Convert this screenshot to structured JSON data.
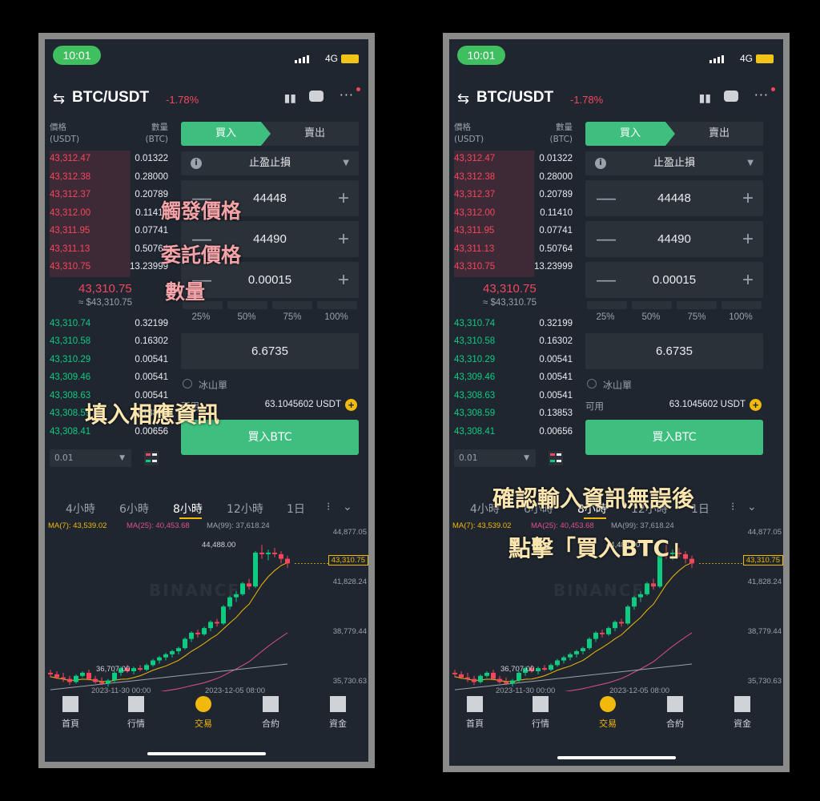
{
  "status": {
    "time": "10:01",
    "network": "4G"
  },
  "header": {
    "pair": "BTC/USDT",
    "change": "-1.78%"
  },
  "orderbook": {
    "price_header": [
      "價格",
      "(USDT)"
    ],
    "qty_header": [
      "數量",
      "(BTC)"
    ],
    "asks": [
      {
        "price": "43,312.47",
        "qty": "0.01322"
      },
      {
        "price": "43,312.38",
        "qty": "0.28000"
      },
      {
        "price": "43,312.37",
        "qty": "0.20789"
      },
      {
        "price": "43,312.00",
        "qty": "0.11410"
      },
      {
        "price": "43,311.95",
        "qty": "0.07741"
      },
      {
        "price": "43,311.13",
        "qty": "0.50764"
      },
      {
        "price": "43,310.75",
        "qty": "13.23999"
      }
    ],
    "last_price": "43,310.75",
    "last_fiat": "≈ $43,310.75",
    "bids": [
      {
        "price": "43,310.74",
        "qty": "0.32199"
      },
      {
        "price": "43,310.58",
        "qty": "0.16302"
      },
      {
        "price": "43,310.29",
        "qty": "0.00541"
      },
      {
        "price": "43,309.46",
        "qty": "0.00541"
      },
      {
        "price": "43,308.63",
        "qty": "0.00541"
      },
      {
        "price": "43,308.59",
        "qty": "0.13853"
      },
      {
        "price": "43,308.41",
        "qty": "0.00656"
      }
    ],
    "depth": "0.01"
  },
  "form": {
    "buy_tab": "買入",
    "sell_tab": "賣出",
    "order_type": "止盈止損",
    "trigger_price": "44448",
    "limit_price": "44490",
    "amount": "0.00015",
    "percents": [
      "25%",
      "50%",
      "75%",
      "100%"
    ],
    "total": "6.6735",
    "iceberg": "冰山單",
    "available_label": "可用",
    "available_value": "63.1045602 USDT",
    "buy_button": "買入BTC"
  },
  "chart": {
    "intervals": [
      "4小時",
      "6小時",
      "8小時",
      "12小時",
      "1日"
    ],
    "active_interval": "8小時",
    "ma7": "MA(7): 43,539.02",
    "ma25": "MA(25): 40,453.68",
    "ma99": "MA(99): 37,618.24",
    "y_ticks": [
      "44,877.05",
      "41,828.24",
      "38,779.44",
      "35,730.63"
    ],
    "last_price_tag": "43,310.75",
    "high_label": "44,488.00",
    "low_label": "36,707.00",
    "x_ticks": [
      "2023-11-30 00:00",
      "2023-12-05 08:00"
    ],
    "watermark": "BINANCE",
    "colors": {
      "up": "#0ecb81",
      "down": "#f6465d",
      "ma7": "#f0b90b",
      "ma25": "#e0508a",
      "ma99": "#9aa1ab"
    }
  },
  "nav": {
    "items": [
      "首頁",
      "行情",
      "交易",
      "合約",
      "資金"
    ],
    "active": "交易"
  },
  "annotations_left": {
    "trigger": "觸發價格",
    "limit": "委託價格",
    "amount": "數量",
    "fill": "填入相應資訊"
  },
  "annotations_right": {
    "line1": "確認輸入資訊無誤後",
    "line2": "點擊「買入BTC」"
  }
}
